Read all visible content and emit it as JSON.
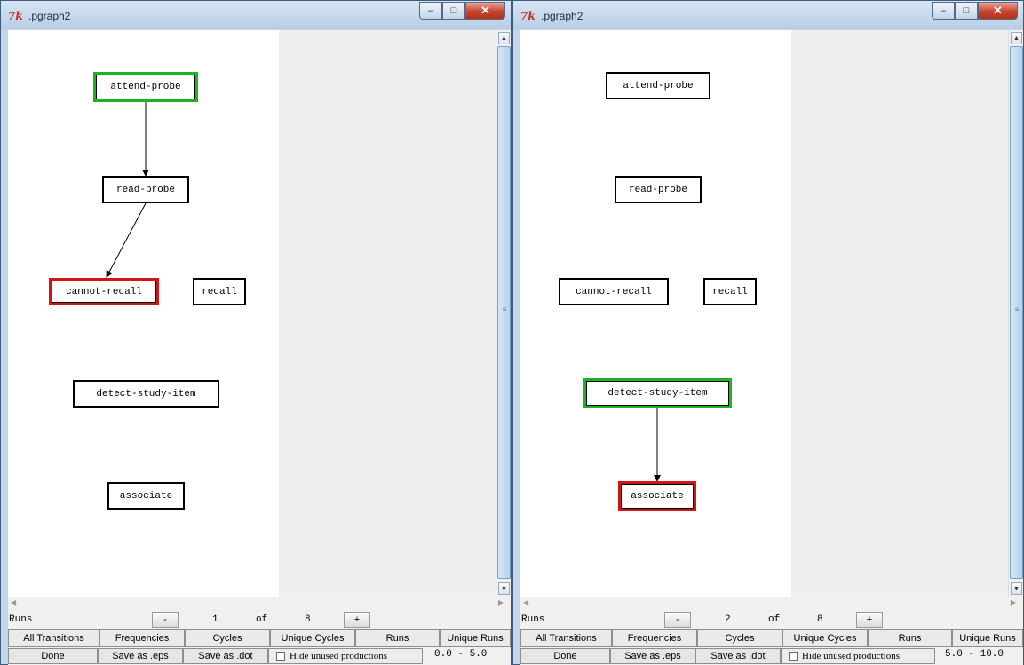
{
  "windows": [
    {
      "title": ".pgraph2",
      "icon_text": "7k",
      "graph": {
        "nodes": [
          {
            "id": "attend-probe",
            "label": "attend-probe",
            "highlight": "green"
          },
          {
            "id": "read-probe",
            "label": "read-probe",
            "highlight": "none"
          },
          {
            "id": "cannot-recall",
            "label": "cannot-recall",
            "highlight": "red"
          },
          {
            "id": "recall",
            "label": "recall",
            "highlight": "none"
          },
          {
            "id": "detect-study-item",
            "label": "detect-study-item",
            "highlight": "none"
          },
          {
            "id": "associate",
            "label": "associate",
            "highlight": "none"
          }
        ],
        "edges": [
          {
            "from": "attend-probe",
            "to": "read-probe"
          },
          {
            "from": "read-probe",
            "to": "cannot-recall"
          }
        ]
      },
      "runs": {
        "label": "Runs",
        "minus": "-",
        "current": "1",
        "of_label": "of",
        "total": "8",
        "plus": "+"
      },
      "tabs": [
        "All Transitions",
        "Frequencies",
        "Cycles",
        "Unique Cycles",
        "Runs",
        "Unique Runs"
      ],
      "bottom": {
        "done": "Done",
        "save_eps": "Save as .eps",
        "save_dot": "Save as .dot",
        "hide_unused": "Hide unused productions",
        "hide_checked": false,
        "range": "0.0 - 5.0"
      }
    },
    {
      "title": ".pgraph2",
      "icon_text": "7k",
      "graph": {
        "nodes": [
          {
            "id": "attend-probe",
            "label": "attend-probe",
            "highlight": "none"
          },
          {
            "id": "read-probe",
            "label": "read-probe",
            "highlight": "none"
          },
          {
            "id": "cannot-recall",
            "label": "cannot-recall",
            "highlight": "none"
          },
          {
            "id": "recall",
            "label": "recall",
            "highlight": "none"
          },
          {
            "id": "detect-study-item",
            "label": "detect-study-item",
            "highlight": "green"
          },
          {
            "id": "associate",
            "label": "associate",
            "highlight": "red"
          }
        ],
        "edges": [
          {
            "from": "detect-study-item",
            "to": "associate"
          }
        ]
      },
      "runs": {
        "label": "Runs",
        "minus": "-",
        "current": "2",
        "of_label": "of",
        "total": "8",
        "plus": "+"
      },
      "tabs": [
        "All Transitions",
        "Frequencies",
        "Cycles",
        "Unique Cycles",
        "Runs",
        "Unique Runs"
      ],
      "bottom": {
        "done": "Done",
        "save_eps": "Save as .eps",
        "save_dot": "Save as .dot",
        "hide_unused": "Hide unused productions",
        "hide_checked": false,
        "range": "5.0 - 10.0"
      }
    }
  ],
  "colors": {
    "highlight_green": "#1db31d",
    "highlight_red": "#d21414",
    "frame": "#c4d6ea"
  },
  "icons": {
    "minimize": "minimize-icon",
    "maximize": "maximize-icon",
    "close": "close-icon",
    "checkbox": "checkbox-icon"
  }
}
